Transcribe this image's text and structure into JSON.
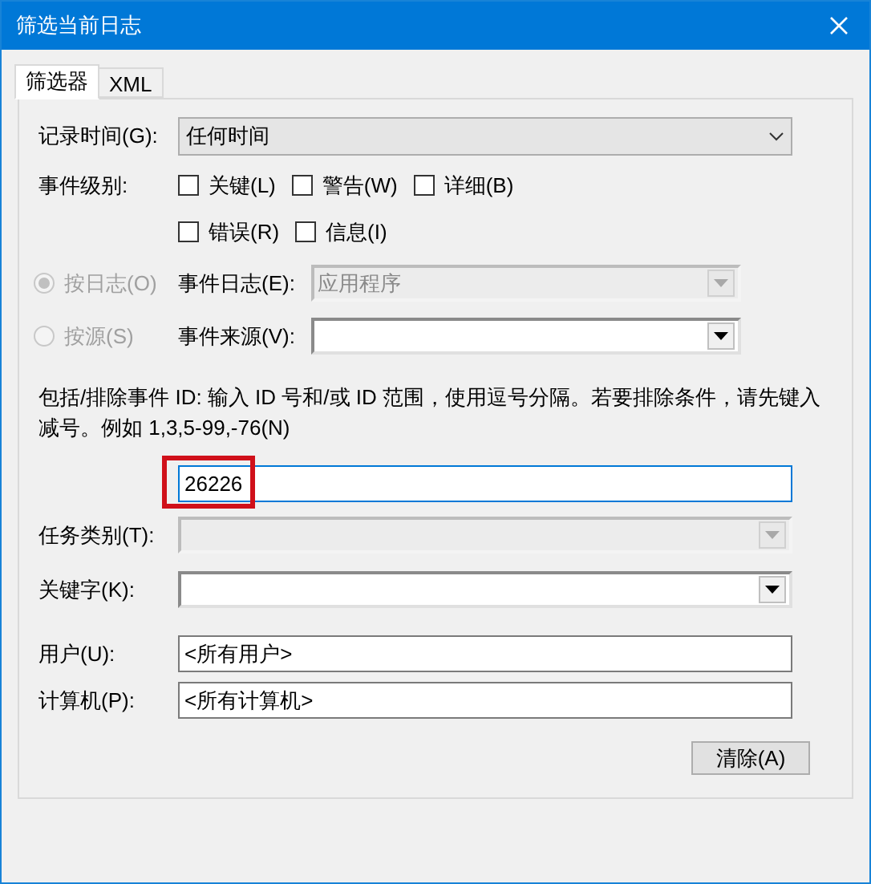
{
  "window": {
    "title": "筛选当前日志"
  },
  "tabs": [
    {
      "label": "筛选器",
      "selected": true
    },
    {
      "label": "XML",
      "selected": false
    }
  ],
  "logged": {
    "label": "记录时间(G):",
    "value": "任何时间"
  },
  "event_level": {
    "label": "事件级别:",
    "rows": [
      {
        "options": [
          {
            "label": "关键(L)",
            "checked": false
          },
          {
            "label": "警告(W)",
            "checked": false
          },
          {
            "label": "详细(B)",
            "checked": false
          }
        ]
      },
      {
        "options": [
          {
            "label": "错误(R)",
            "checked": false
          },
          {
            "label": "信息(I)",
            "checked": false
          }
        ]
      }
    ]
  },
  "sources": [
    {
      "label": "按日志(O)",
      "selected": true,
      "disabled": true,
      "field_label": "事件日志(E):",
      "value": "应用程序",
      "field_disabled": true
    },
    {
      "label": "按源(S)",
      "selected": false,
      "disabled": true,
      "field_label": "事件来源(V):",
      "field_disabled": false
    }
  ],
  "id_hint": "包括/排除事件 ID: 输入 ID 号和/或 ID 范围，使用逗号分隔。若要排除条件，请先键入减号。例如 1,3,5-99,-76(N)",
  "id_value": "26226",
  "combos": [
    {
      "label": "任务类别(T):",
      "disabled": true
    },
    {
      "label": "关键字(K):",
      "disabled": false
    }
  ],
  "texts": [
    {
      "label": "用户(U):",
      "value": "<所有用户>"
    },
    {
      "label": "计算机(P):",
      "value": "<所有计算机>"
    }
  ],
  "clear_button": "清除(A)"
}
